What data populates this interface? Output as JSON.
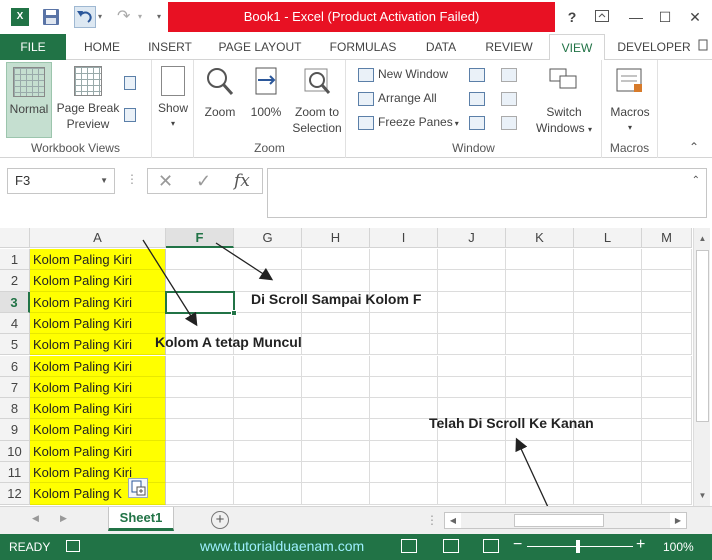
{
  "titlebar": {
    "app_icon": "X",
    "title": "Book1 -  Excel (Product Activation Failed)",
    "help": "?",
    "ribbon_display_icon": "ribbon-display-icon",
    "minimize": "—",
    "maximize": "☐",
    "close": "✕",
    "title_color": "#e81123"
  },
  "tabs": [
    "FILE",
    "HOME",
    "INSERT",
    "PAGE LAYOUT",
    "FORMULAS",
    "DATA",
    "REVIEW",
    "VIEW",
    "DEVELOPER"
  ],
  "ribbon": {
    "workbook_views": {
      "label": "Workbook Views",
      "normal": "Normal",
      "page_break_1": "Page Break",
      "page_break_2": "Preview"
    },
    "show": {
      "label": "Show"
    },
    "zoom": {
      "label": "Zoom",
      "zoom": "Zoom",
      "zoom100": "100%",
      "zoom_sel_1": "Zoom to",
      "zoom_sel_2": "Selection"
    },
    "window": {
      "label": "Window",
      "new_window": "New Window",
      "arrange_all": "Arrange All",
      "freeze_panes": "Freeze Panes",
      "switch_1": "Switch",
      "switch_2": "Windows"
    },
    "macros": {
      "label": "Macros",
      "macros": "Macros"
    }
  },
  "formula_bar": {
    "name_box": "F3",
    "cancel": "✕",
    "enter": "✓",
    "fx": "fx",
    "value": ""
  },
  "grid": {
    "columns": [
      "A",
      "F",
      "G",
      "H",
      "I",
      "J",
      "K",
      "L",
      "M"
    ],
    "selected_column": "F",
    "rows": [
      "1",
      "2",
      "3",
      "4",
      "5",
      "6",
      "7",
      "8",
      "9",
      "10",
      "11",
      "12"
    ],
    "selected_row": "3",
    "a_cell_text": "Kolom Paling Kiri",
    "a_cells": [
      "Kolom Paling Kiri",
      "Kolom Paling Kiri",
      "Kolom Paling Kiri",
      "Kolom Paling Kiri",
      "Kolom Paling Kiri",
      "Kolom Paling Kiri",
      "Kolom Paling Kiri",
      "Kolom Paling Kiri",
      "Kolom Paling Kiri",
      "Kolom Paling Kiri",
      "Kolom Paling Kiri",
      "Kolom Paling K"
    ],
    "a_color": "#ffff00"
  },
  "annotations": {
    "scroll_f": "Di Scroll Sampai Kolom F",
    "kolom_a": "Kolom A tetap Muncul",
    "scroll_right": "Telah Di Scroll Ke Kanan"
  },
  "sheets": {
    "active": "Sheet1",
    "add": "+"
  },
  "statusbar": {
    "ready": "READY",
    "watermark": "www.tutorialduaenam.com",
    "zoom": "100%",
    "accent": "#217346"
  }
}
